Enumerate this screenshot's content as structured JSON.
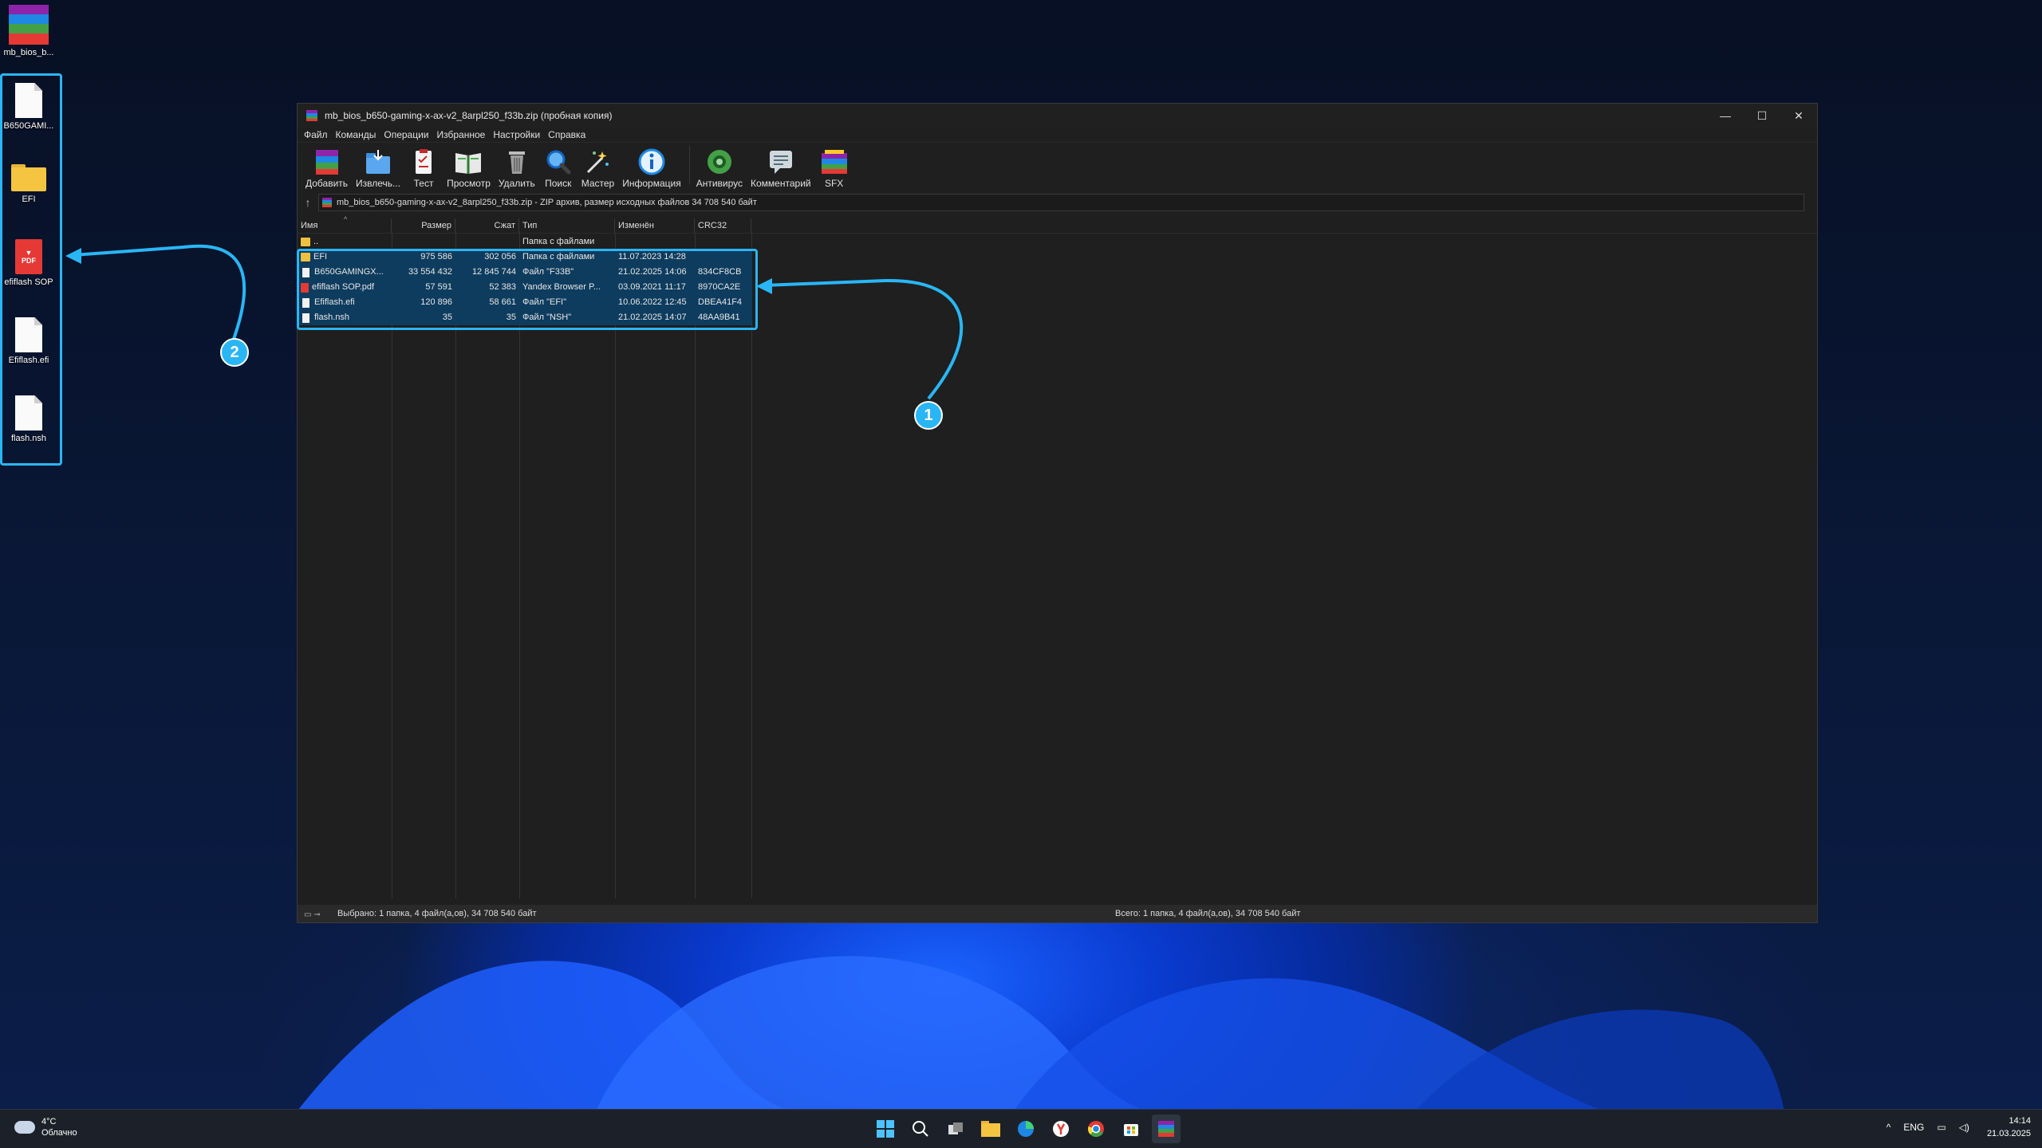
{
  "desktop": {
    "top_icon_label": "mb_bios_b...",
    "selected_icons": [
      {
        "label": "B650GAMI...",
        "kind": "doc"
      },
      {
        "label": "EFI",
        "kind": "folder"
      },
      {
        "label": "efiflash SOP",
        "kind": "pdf"
      },
      {
        "label": "Efiflash.efi",
        "kind": "doc"
      },
      {
        "label": "flash.nsh",
        "kind": "doc"
      }
    ]
  },
  "window": {
    "title": "mb_bios_b650-gaming-x-ax-v2_8arpl250_f33b.zip (пробная копия)",
    "menu": [
      "Файл",
      "Команды",
      "Операции",
      "Избранное",
      "Настройки",
      "Справка"
    ],
    "toolbar": [
      {
        "label": "Добавить",
        "icon": "add-archive-icon"
      },
      {
        "label": "Извлечь...",
        "icon": "extract-icon"
      },
      {
        "label": "Тест",
        "icon": "test-icon"
      },
      {
        "label": "Просмотр",
        "icon": "view-icon"
      },
      {
        "label": "Удалить",
        "icon": "delete-icon"
      },
      {
        "label": "Поиск",
        "icon": "search-icon"
      },
      {
        "label": "Мастер",
        "icon": "wizard-icon"
      },
      {
        "label": "Информация",
        "icon": "info-icon"
      },
      {
        "label": "Антивирус",
        "icon": "antivirus-icon"
      },
      {
        "label": "Комментарий",
        "icon": "comment-icon"
      },
      {
        "label": "SFX",
        "icon": "sfx-icon"
      }
    ],
    "address": "mb_bios_b650-gaming-x-ax-v2_8arpl250_f33b.zip - ZIP архив, размер исходных файлов 34 708 540 байт",
    "columns": {
      "name": "Имя",
      "size": "Размер",
      "packed": "Сжат",
      "type": "Тип",
      "modified": "Изменён",
      "crc": "CRC32"
    },
    "parent_row": {
      "name": "..",
      "type": "Папка с файлами"
    },
    "files": [
      {
        "name": "EFI",
        "size": "975 586",
        "packed": "302 056",
        "type": "Папка с файлами",
        "modified": "11.07.2023 14:28",
        "crc": "",
        "kind": "folder"
      },
      {
        "name": "B650GAMINGX...",
        "size": "33 554 432",
        "packed": "12 845 744",
        "type": "Файл \"F33B\"",
        "modified": "21.02.2025 14:06",
        "crc": "834CF8CB",
        "kind": "doc"
      },
      {
        "name": "efiflash SOP.pdf",
        "size": "57 591",
        "packed": "52 383",
        "type": "Yandex Browser P...",
        "modified": "03.09.2021 11:17",
        "crc": "8970CA2E",
        "kind": "pdf"
      },
      {
        "name": "Efiflash.efi",
        "size": "120 896",
        "packed": "58 661",
        "type": "Файл \"EFI\"",
        "modified": "10.06.2022 12:45",
        "crc": "DBEA41F4",
        "kind": "doc"
      },
      {
        "name": "flash.nsh",
        "size": "35",
        "packed": "35",
        "type": "Файл \"NSH\"",
        "modified": "21.02.2025 14:07",
        "crc": "48AA9B41",
        "kind": "doc"
      }
    ],
    "status_left": "Выбрано: 1 папка, 4 файл(а,ов), 34 708 540 байт",
    "status_right": "Всего: 1 папка, 4 файл(а,ов), 34 708 540 байт"
  },
  "annotations": {
    "badge1": "1",
    "badge2": "2",
    "color": "#29b6f6"
  },
  "taskbar": {
    "temperature": "4°C",
    "weather": "Облачно",
    "lang": "ENG",
    "time": "14:14",
    "date": "21.03.2025"
  }
}
